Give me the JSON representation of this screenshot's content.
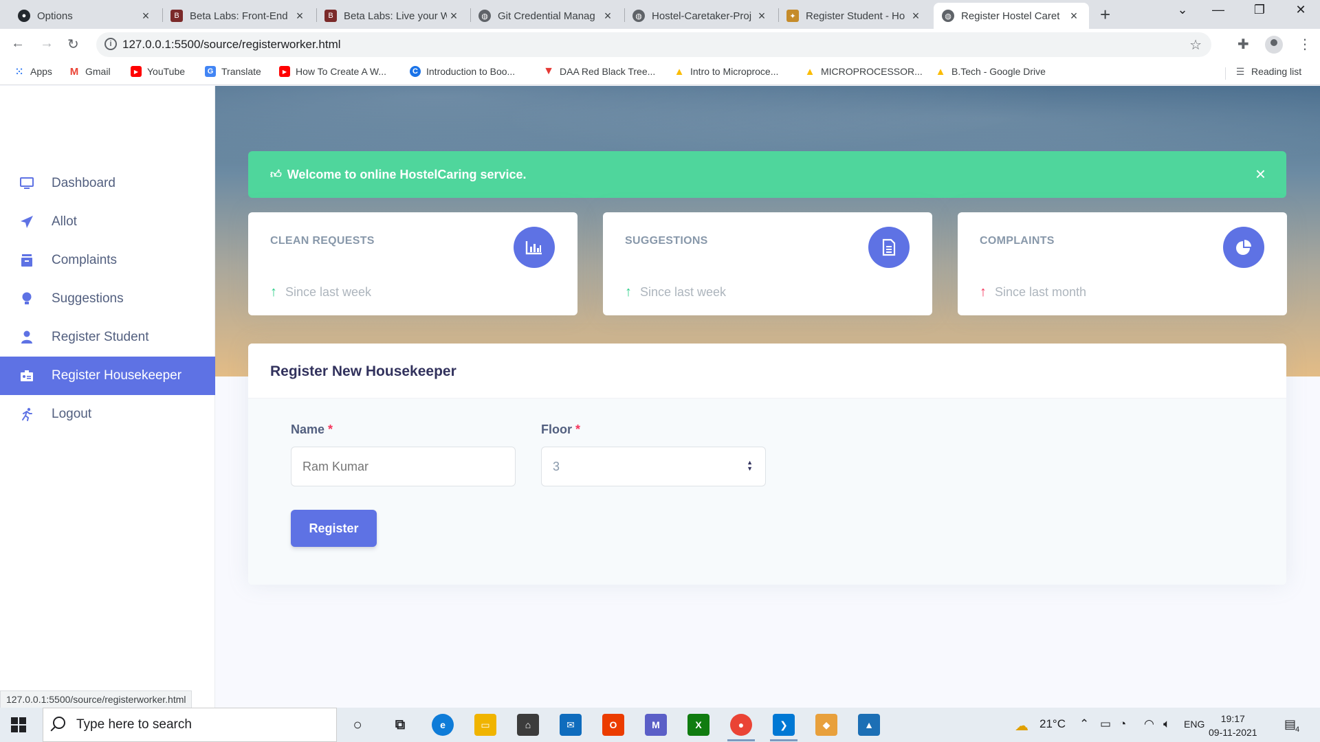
{
  "browser": {
    "tabs": [
      {
        "title": "Options",
        "icon": "github-icon",
        "color": "#24292e"
      },
      {
        "title": "Beta Labs: Front-End",
        "icon": "betalabs-icon",
        "color": "#7b2a2a"
      },
      {
        "title": "Beta Labs: Live your W",
        "icon": "betalabs-icon",
        "color": "#7b2a2a"
      },
      {
        "title": "Git Credential Manag",
        "icon": "globe-icon",
        "color": "#5f6368"
      },
      {
        "title": "Hostel-Caretaker-Proj",
        "icon": "globe-icon",
        "color": "#5f6368"
      },
      {
        "title": "Register Student - Ho",
        "icon": "broom-icon",
        "color": "#c58b2a"
      },
      {
        "title": "Register Hostel Caret",
        "icon": "globe-icon",
        "color": "#5f6368"
      }
    ],
    "new_tab": "+",
    "url": "127.0.0.1:5500/source/registerworker.html",
    "bookmarks": [
      {
        "label": "Apps",
        "icon": "apps-grid-icon",
        "color": "#4285f4"
      },
      {
        "label": "Gmail",
        "icon": "gmail-icon",
        "color": "#ea4335"
      },
      {
        "label": "YouTube",
        "icon": "youtube-icon",
        "color": "#ff0000"
      },
      {
        "label": "Translate",
        "icon": "translate-icon",
        "color": "#4285f4"
      },
      {
        "label": "How To Create A W...",
        "icon": "youtube-icon",
        "color": "#ff0000"
      },
      {
        "label": "Introduction to Boo...",
        "icon": "c-logo-icon",
        "color": "#1a73e8"
      },
      {
        "label": "DAA Red Black Tree...",
        "icon": "v-logo-icon",
        "color": "#e53935"
      },
      {
        "label": "Intro to Microproce...",
        "icon": "drive-icon",
        "color": "#fbbc04"
      },
      {
        "label": "MICROPROCESSOR...",
        "icon": "drive-icon",
        "color": "#fbbc04"
      },
      {
        "label": "B.Tech - Google Drive",
        "icon": "drive-icon",
        "color": "#fbbc04"
      }
    ],
    "reading_list": "Reading list",
    "status_url": "127.0.0.1:5500/source/registerworker.html"
  },
  "sidebar": {
    "items": [
      {
        "label": "Dashboard",
        "icon": "monitor-icon",
        "color": "#5e72e4"
      },
      {
        "label": "Allot",
        "icon": "paper-plane-icon",
        "color": "#5e72e4"
      },
      {
        "label": "Complaints",
        "icon": "archive-icon",
        "color": "#5e72e4"
      },
      {
        "label": "Suggestions",
        "icon": "bulb-icon",
        "color": "#5e72e4"
      },
      {
        "label": "Register Student",
        "icon": "user-icon",
        "color": "#5e72e4"
      },
      {
        "label": "Register Housekeeper",
        "icon": "badge-icon",
        "color": "#ffffff"
      },
      {
        "label": "Logout",
        "icon": "running-icon",
        "color": "#5e72e4"
      }
    ],
    "active": "Register Housekeeper"
  },
  "alert": {
    "text": "Welcome to online HostelCaring service.",
    "close": "×"
  },
  "stats": [
    {
      "title": "CLEAN REQUESTS",
      "icon": "bar-chart-icon",
      "footer": "Since last week",
      "trend": "up",
      "trend_color": "#2dce89"
    },
    {
      "title": "SUGGESTIONS",
      "icon": "document-icon",
      "footer": "Since last week",
      "trend": "up",
      "trend_color": "#2dce89"
    },
    {
      "title": "COMPLAINTS",
      "icon": "pie-chart-icon",
      "footer": "Since last month",
      "trend": "up",
      "trend_color": "#f5365c"
    }
  ],
  "form": {
    "heading": "Register New Housekeeper",
    "name_label": "Name",
    "name_placeholder": "Ram Kumar",
    "floor_label": "Floor",
    "floor_value": "3",
    "required_mark": "*",
    "submit": "Register"
  },
  "taskbar": {
    "search_placeholder": "Type here to search",
    "weather": "21°C",
    "language": "ENG",
    "time": "19:17",
    "date": "09-11-2021",
    "notifications": "4"
  },
  "colors": {
    "primary": "#5e72e4",
    "success": "#4fd69c",
    "danger": "#f5365c"
  }
}
